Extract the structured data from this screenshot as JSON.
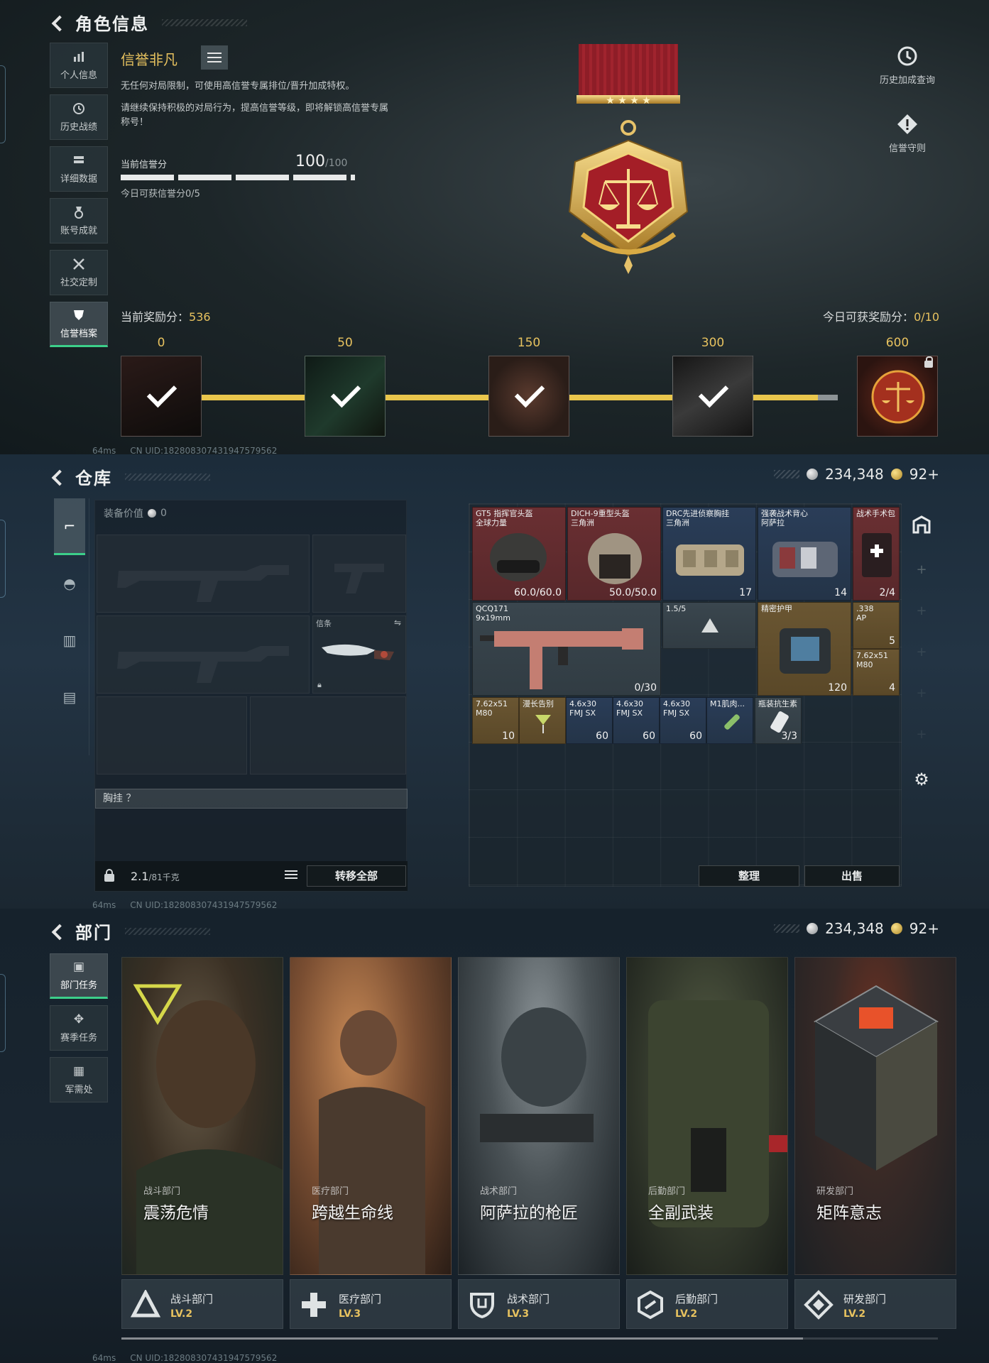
{
  "profile": {
    "back_title": "角色信息",
    "tabs": [
      {
        "label": "个人信息",
        "icon": "bar-chart-icon"
      },
      {
        "label": "历史战绩",
        "icon": "clock-icon"
      },
      {
        "label": "详细数据",
        "icon": "stack-icon"
      },
      {
        "label": "账号成就",
        "icon": "medal-icon"
      },
      {
        "label": "社交定制",
        "icon": "crossed-tools-icon"
      },
      {
        "label": "信誉档案",
        "icon": "shield-badge-icon"
      }
    ],
    "honor_name": "信誉非凡",
    "desc1": "无任何对局限制，可使用高信誉专属排位/晋升加成特权。",
    "desc2a": "请继续保持积极的对局行为，提高信誉等级，即将解锁高信誉专属",
    "desc2b": "称号！",
    "score_label": "当前信誉分",
    "score_value": "100",
    "score_max": "/100",
    "today_label": "今日可获信誉分0/5",
    "history_btn": "历史加成查询",
    "rules_btn": "信誉守则",
    "current_reward_label": "当前奖励分：",
    "current_reward_value": "536",
    "today_reward_label": "今日可获奖励分：",
    "today_reward_value": "0/10",
    "milestones": [
      "0",
      "50",
      "150",
      "300",
      "600"
    ],
    "net_ping": "64ms",
    "uid": "CN UID:182808307431947579562"
  },
  "warehouse": {
    "back_title": "仓库",
    "silver": "234,348",
    "gold": "92+",
    "equip_value_label": "装备价值",
    "equip_value": "0",
    "knife_slot_label": "信条",
    "chest_label": "胸挂 ？",
    "weight": "2.1",
    "weight_unit": "/81千克",
    "transfer_all": "转移全部",
    "sort_btn": "整理",
    "sell_btn": "出售",
    "items": [
      {
        "name": "GT5 指挥官头盔",
        "sub": "全球力量",
        "qty": "60.0/60.0"
      },
      {
        "name": "DICH-9重型头盔",
        "sub": "三角洲",
        "qty": "50.0/50.0"
      },
      {
        "name": "DRC先进侦察胸挂",
        "sub": "三角洲",
        "qty": "17"
      },
      {
        "name": "强袭战术背心",
        "sub": "阿萨拉",
        "qty": "14"
      },
      {
        "name": "战术手术包",
        "sub": "",
        "qty": "2/4"
      },
      {
        "name": "QCQ171",
        "sub": "9x19mm",
        "qty": "0/30"
      },
      {
        "name": "1.5/5",
        "sub": "",
        "qty": ""
      },
      {
        "name": "精密护甲",
        "sub": "",
        "qty": "120"
      },
      {
        "name": ".338",
        "sub": "AP",
        "qty": "5"
      },
      {
        "name": "7.62x51",
        "sub": "M80",
        "qty": "4"
      },
      {
        "name": "7.62x51",
        "sub": "M80",
        "qty": "10"
      },
      {
        "name": "漫长告别",
        "sub": "",
        "qty": ""
      },
      {
        "name": "4.6x30",
        "sub": "FMJ SX",
        "qty": "60"
      },
      {
        "name": "4.6x30",
        "sub": "FMJ SX",
        "qty": "60"
      },
      {
        "name": "4.6x30",
        "sub": "FMJ SX",
        "qty": "60"
      },
      {
        "name": "M1肌肉...",
        "sub": "",
        "qty": ""
      },
      {
        "name": "瓶装抗生素",
        "sub": "",
        "qty": "3/3"
      }
    ],
    "net_ping": "64ms",
    "uid": "CN UID:182808307431947579562"
  },
  "departments": {
    "back_title": "部门",
    "silver": "234,348",
    "gold": "92+",
    "tabs": [
      {
        "label": "部门任务",
        "icon": "task-icon"
      },
      {
        "label": "赛季任务",
        "icon": "season-icon"
      },
      {
        "label": "军需处",
        "icon": "supply-icon"
      }
    ],
    "cards": [
      {
        "sub": "战斗部门",
        "title": "震荡危情",
        "dept": "战斗部门",
        "level": "LV.2",
        "accent": "#c9a24a"
      },
      {
        "sub": "医疗部门",
        "title": "跨越生命线",
        "dept": "医疗部门",
        "level": "LV.3",
        "accent": "#c8894e"
      },
      {
        "sub": "战术部门",
        "title": "阿萨拉的枪匠",
        "dept": "战术部门",
        "level": "LV.3",
        "accent": "#8a9aa2"
      },
      {
        "sub": "后勤部门",
        "title": "全副武装",
        "dept": "后勤部门",
        "level": "LV.2",
        "accent": "#6f7a5a"
      },
      {
        "sub": "研发部门",
        "title": "矩阵意志",
        "dept": "研发部门",
        "level": "LV.2",
        "accent": "#d2552e"
      }
    ],
    "net_ping": "64ms",
    "uid": "CN UID:182808307431947579562"
  }
}
